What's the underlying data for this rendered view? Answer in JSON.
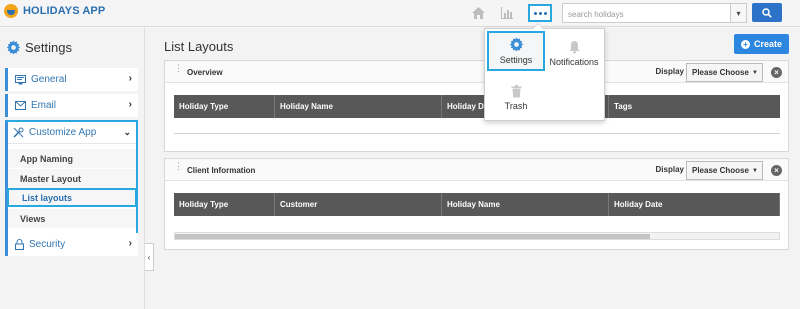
{
  "app": {
    "name": "HOLIDAYS APP"
  },
  "topbar": {
    "search_placeholder": "search holidays",
    "home_icon": "home-icon",
    "chart_icon": "bar-chart-icon",
    "more_icon": "ellipsis-icon"
  },
  "sidebar": {
    "title": "Settings",
    "items": [
      {
        "label": "General",
        "icon": "monitor-icon"
      },
      {
        "label": "Email",
        "icon": "envelope-icon"
      },
      {
        "label": "Customize App",
        "icon": "tools-icon"
      },
      {
        "label": "Security",
        "icon": "lock-icon"
      }
    ],
    "subitems": [
      {
        "label": "App Naming"
      },
      {
        "label": "Master Layout"
      },
      {
        "label": "List layouts"
      },
      {
        "label": "Views"
      }
    ]
  },
  "main": {
    "title": "List Layouts",
    "create_label": "Create",
    "panels": [
      {
        "title": "Overview",
        "display_label": "Display",
        "display_value": "Please Choose",
        "columns": [
          "Holiday Type",
          "Holiday Name",
          "Holiday Da",
          "",
          "Tags"
        ]
      },
      {
        "title": "Client Information",
        "display_label": "Display",
        "display_value": "Please Choose",
        "columns": [
          "Holiday Type",
          "Customer",
          "Holiday Name",
          "Holiday Date"
        ]
      }
    ]
  },
  "dropdown": {
    "items": [
      {
        "label": "Settings",
        "icon": "gear-icon"
      },
      {
        "label": "Notifications",
        "icon": "bell-icon"
      },
      {
        "label": "Trash",
        "icon": "trash-icon"
      }
    ]
  },
  "colors": {
    "accent": "#29a8e0",
    "primary": "#2d72c9",
    "link": "#3276b1",
    "table_header": "#585858"
  }
}
